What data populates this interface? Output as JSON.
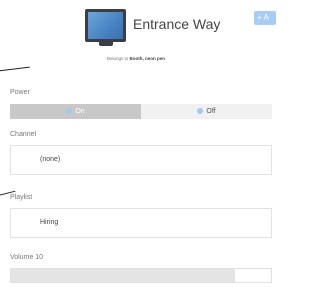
{
  "header": {
    "title": "Entrance Way",
    "add_label": "+ A",
    "subtitle_prefix": "Belongs to",
    "subtitle_owner": "Booth, neon pen",
    "icon": "monitor-icon"
  },
  "power": {
    "label": "Power",
    "on_label": "On",
    "off_label": "Off",
    "selected": "On"
  },
  "channel": {
    "label": "Channel",
    "value": "(none)"
  },
  "playlist": {
    "label": "Playlist",
    "value": "Hiring"
  },
  "volume": {
    "label": "Volume 10",
    "fill_fraction": 0.86
  },
  "colors": {
    "accent": "#a7c7ec",
    "toggle_on_bg": "#c8c8c8",
    "toggle_off_bg": "#f1f1f1"
  }
}
